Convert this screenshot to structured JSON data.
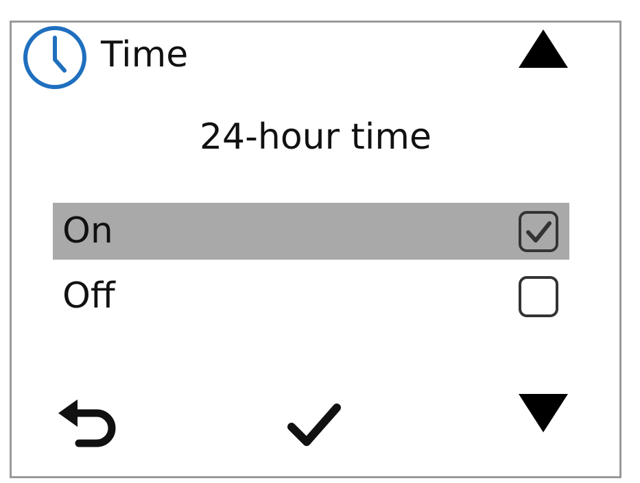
{
  "header": {
    "icon": "clock-icon",
    "title": "Time",
    "accent_color": "#1f6fbf"
  },
  "setting": {
    "name": "24-hour time"
  },
  "options": [
    {
      "label": "On",
      "checked": true
    },
    {
      "label": "Off",
      "checked": false
    }
  ],
  "footer": {
    "back_icon": "back-arrow-icon",
    "confirm_icon": "checkmark-icon",
    "down_icon": "down-arrow-icon"
  },
  "colors": {
    "selection": "#a9a9a9",
    "frame": "#999999",
    "foreground": "#111111"
  }
}
